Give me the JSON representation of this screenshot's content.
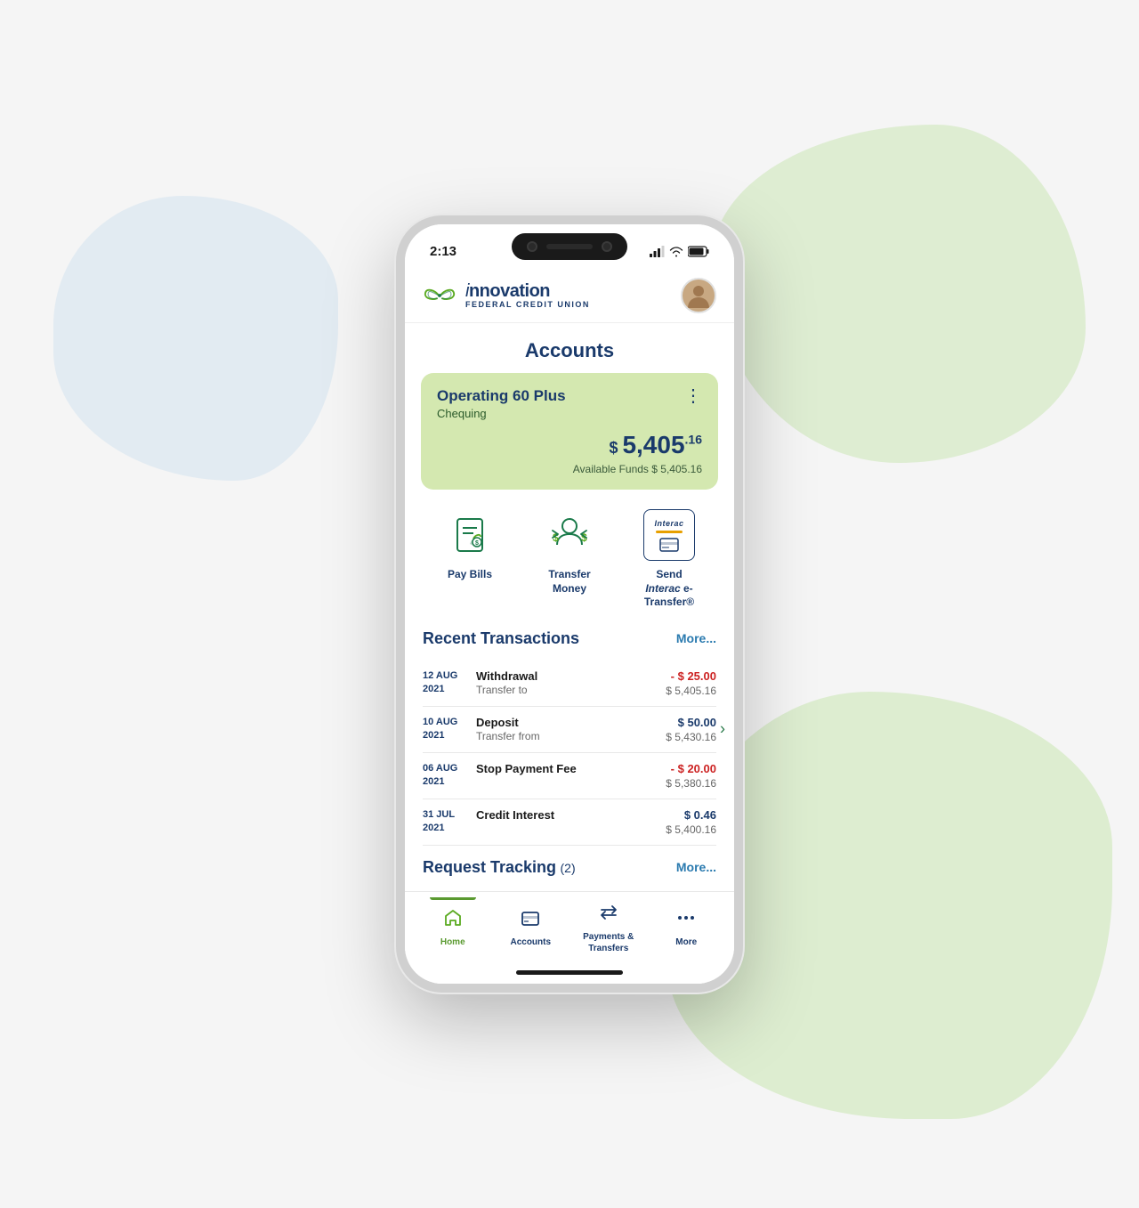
{
  "background": {
    "blob_blue": "blue background blob",
    "blob_green_top": "green background blob top right",
    "blob_green_bottom": "green background blob bottom right"
  },
  "status_bar": {
    "time": "2:13",
    "signal": "signal bars",
    "wifi": "wifi icon",
    "battery": "battery icon"
  },
  "header": {
    "logo_innovation": "innovation",
    "logo_bold_part": "novation",
    "logo_subtitle": "FEDERAL CREDIT UNION",
    "avatar_alt": "user avatar"
  },
  "accounts_section": {
    "title": "Accounts",
    "card": {
      "name": "Operating 60 Plus",
      "type": "Chequing",
      "balance_prefix": "$ ",
      "balance_main": "5,405",
      "balance_cents": ".16",
      "available_label": "Available Funds",
      "available_amount": "$ 5,405.16",
      "menu_icon": "⋮"
    }
  },
  "quick_actions": [
    {
      "id": "pay-bills",
      "label": "Pay Bills",
      "icon_type": "pay-bills"
    },
    {
      "id": "transfer-money",
      "label": "Transfer Money",
      "icon_type": "transfer-money"
    },
    {
      "id": "send-etransfer",
      "label": "Send Interac e-Transfer®",
      "icon_type": "interac"
    }
  ],
  "transactions": {
    "section_title": "Recent Transactions",
    "more_label": "More...",
    "items": [
      {
        "date_line1": "12 AUG",
        "date_line2": "2021",
        "title": "Withdrawal",
        "subtitle": "Transfer to",
        "amount": "- $ 25.00",
        "is_negative": true,
        "balance": "$ 5,405.16",
        "has_arrow": false
      },
      {
        "date_line1": "10 AUG",
        "date_line2": "2021",
        "title": "Deposit",
        "subtitle": "Transfer from",
        "amount": "$ 50.00",
        "is_negative": false,
        "balance": "$ 5,430.16",
        "has_arrow": true
      },
      {
        "date_line1": "06 AUG",
        "date_line2": "2021",
        "title": "Stop Payment Fee",
        "subtitle": "",
        "amount": "- $ 20.00",
        "is_negative": true,
        "balance": "$ 5,380.16",
        "has_arrow": false
      },
      {
        "date_line1": "31 JUL",
        "date_line2": "2021",
        "title": "Credit Interest",
        "subtitle": "",
        "amount": "$ 0.46",
        "is_negative": false,
        "balance": "$ 5,400.16",
        "has_arrow": false
      }
    ]
  },
  "request_tracking": {
    "title": "Request Tracking",
    "count": "(2)",
    "more_label": "More..."
  },
  "bottom_nav": [
    {
      "id": "home",
      "label": "Home",
      "icon": "home",
      "active": true
    },
    {
      "id": "accounts",
      "label": "Accounts",
      "icon": "accounts",
      "active": false
    },
    {
      "id": "payments-transfers",
      "label": "Payments & Transfers",
      "icon": "transfers",
      "active": false
    },
    {
      "id": "more",
      "label": "More",
      "icon": "more",
      "active": false
    }
  ]
}
